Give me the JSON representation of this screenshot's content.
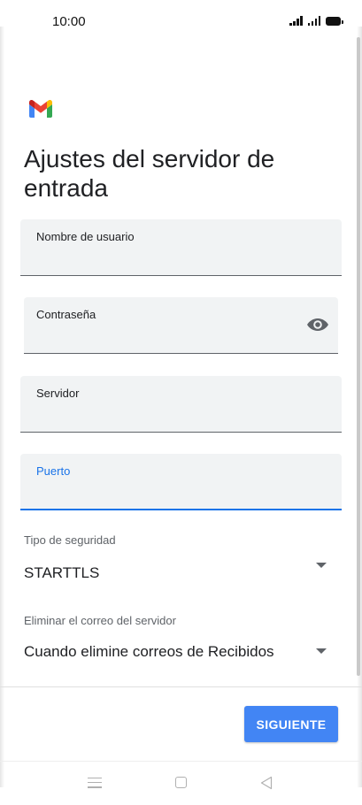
{
  "status_bar": {
    "time": "10:00",
    "icons": [
      "signal-icon",
      "signal-icon",
      "battery-icon"
    ]
  },
  "app": {
    "logo": "gmail-logo"
  },
  "page": {
    "title": "Ajustes del servidor de entrada"
  },
  "fields": {
    "username": {
      "label": "Nombre de usuario",
      "value": ""
    },
    "password": {
      "label": "Contraseña",
      "value": "",
      "toggle_icon": "eye-icon"
    },
    "server": {
      "label": "Servidor",
      "value": ""
    },
    "port": {
      "label": "Puerto",
      "value": "",
      "focused": true
    }
  },
  "selects": {
    "security": {
      "label": "Tipo de seguridad",
      "value": "STARTTLS"
    },
    "delete_from_server": {
      "label": "Eliminar el correo del servidor",
      "value": "Cuando elimine correos de Recibidos"
    }
  },
  "actions": {
    "next_label": "SIGUIENTE"
  },
  "colors": {
    "accent": "#1a73e8",
    "button": "#4285f4",
    "field_bg": "#f1f3f4"
  },
  "nav_bar": {
    "icons": [
      "menu-icon",
      "home-icon",
      "back-icon"
    ]
  }
}
